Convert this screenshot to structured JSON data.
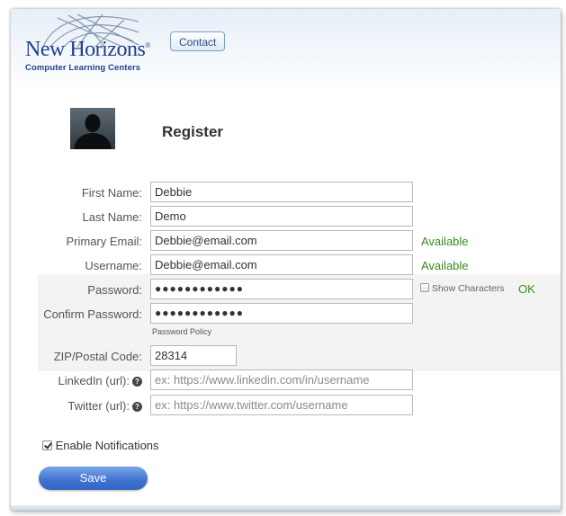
{
  "header": {
    "logo_name": "New Horizons",
    "logo_reg": "®",
    "logo_subtitle": "Computer Learning Centers",
    "contact_label": "Contact"
  },
  "page": {
    "title": "Register"
  },
  "form": {
    "first_name": {
      "label": "First Name:",
      "value": "Debbie"
    },
    "last_name": {
      "label": "Last Name:",
      "value": "Demo"
    },
    "primary_email": {
      "label": "Primary Email:",
      "value": "Debbie@email.com",
      "status": "Available"
    },
    "username": {
      "label": "Username:",
      "value": "Debbie@email.com",
      "status": "Available"
    },
    "password": {
      "label": "Password:",
      "masked": "●●●●●●●●●●●●",
      "show_characters": "Show Characters",
      "status": "OK"
    },
    "confirm_password": {
      "label": "Confirm Password:",
      "masked": "●●●●●●●●●●●●",
      "policy": "Password Policy"
    },
    "zip": {
      "label": "ZIP/Postal Code:",
      "value": "28314"
    },
    "linkedin": {
      "label": "LinkedIn (url):",
      "placeholder": "ex: https://www.linkedin.com/in/username",
      "help": "?"
    },
    "twitter": {
      "label": "Twitter (url):",
      "placeholder": "ex: https://www.twitter.com/username",
      "help": "?"
    },
    "notifications": {
      "label": "Enable Notifications",
      "checked": true
    },
    "save_label": "Save"
  },
  "colors": {
    "accent": "#3f72cf",
    "status_ok": "#3a8a1e",
    "brand": "#1d3f8f"
  },
  "icons": [
    "globe-logo-icon",
    "help-icon",
    "checkbox-icon",
    "avatar-icon"
  ]
}
